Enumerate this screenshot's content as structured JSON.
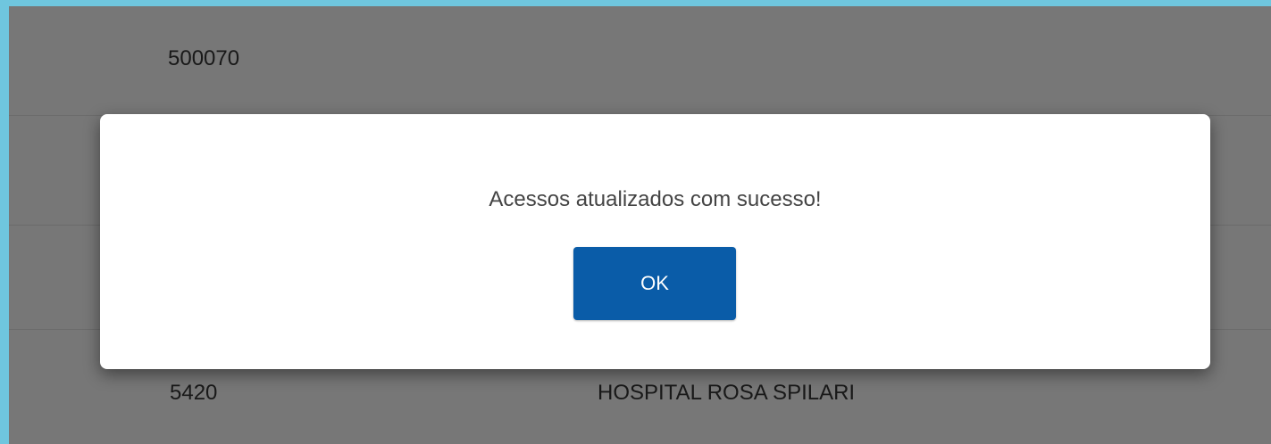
{
  "background_table": {
    "rows": [
      {
        "code": "500070",
        "name": ""
      },
      {
        "code": "",
        "name": ""
      },
      {
        "code": "",
        "name": ""
      },
      {
        "code": "5420",
        "name": "HOSPITAL ROSA SPILARI"
      }
    ]
  },
  "dialog": {
    "message": "Acessos atualizados com sucesso!",
    "ok_label": "OK"
  },
  "colors": {
    "frame_border": "#6fc6de",
    "overlay": "rgba(0,0,0,0.5)",
    "ok_button_bg": "#0a5ca8",
    "ok_button_text": "#ffffff"
  }
}
